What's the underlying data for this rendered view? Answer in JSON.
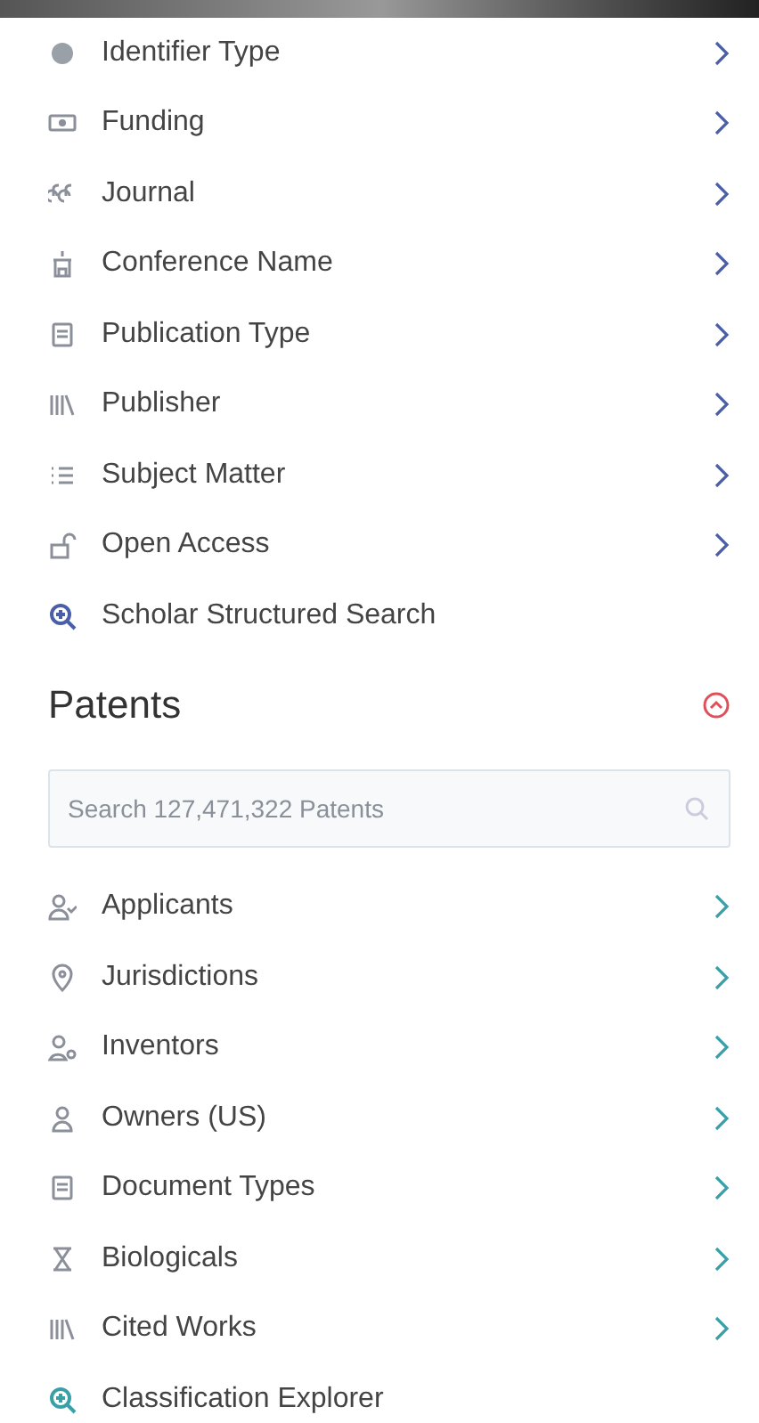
{
  "scholar_filters": [
    {
      "label": "Identifier Type",
      "kind": "filter"
    },
    {
      "label": "Funding",
      "kind": "filter"
    },
    {
      "label": "Journal",
      "kind": "filter"
    },
    {
      "label": "Conference Name",
      "kind": "filter"
    },
    {
      "label": "Publication Type",
      "kind": "filter"
    },
    {
      "label": "Publisher",
      "kind": "filter"
    },
    {
      "label": "Subject Matter",
      "kind": "filter"
    },
    {
      "label": "Open Access",
      "kind": "filter"
    },
    {
      "label": "Scholar Structured Search",
      "kind": "tool"
    }
  ],
  "patents": {
    "title": "Patents",
    "expanded": true,
    "search": {
      "placeholder": "Search 127,471,322 Patents"
    },
    "filters": [
      {
        "label": "Applicants",
        "kind": "filter"
      },
      {
        "label": "Jurisdictions",
        "kind": "filter"
      },
      {
        "label": "Inventors",
        "kind": "filter"
      },
      {
        "label": "Owners (US)",
        "kind": "filter"
      },
      {
        "label": "Document Types",
        "kind": "filter"
      },
      {
        "label": "Biologicals",
        "kind": "filter"
      },
      {
        "label": "Cited Works",
        "kind": "filter"
      },
      {
        "label": "Classification Explorer",
        "kind": "tool"
      }
    ]
  }
}
